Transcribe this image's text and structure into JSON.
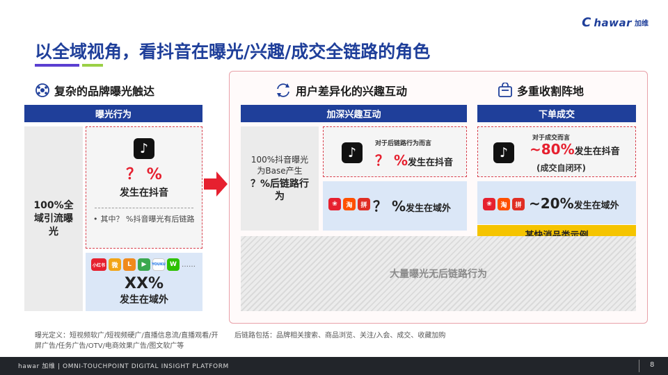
{
  "logo": {
    "text": "hawar",
    "cn": "加维"
  },
  "title": "以全域视角，看抖音在曝光/兴趣/成交全链路的角色",
  "left": {
    "heading": "复杂的品牌曝光触达",
    "bar": "曝光行为",
    "full_domain": "100%全域引流曝光",
    "pct": "？ %",
    "in_douyin": "发生在抖音",
    "note": "其中？ %抖音曝光有后链路",
    "xx": "XX%",
    "outside": "发生在域外",
    "platforms": [
      "小红书",
      "微",
      "L",
      "▶",
      "YOUKU",
      "W"
    ],
    "ellipsis": "……"
  },
  "mid": {
    "heading": "用户差异化的兴趣互动",
    "bar": "加深兴趣互动",
    "base_text": "100%抖音曝光为Base产生",
    "base_pct": "？%后链路行为",
    "for_chain": "对于后链路行为而言",
    "pct_douyin": "？ %",
    "pct_douyin_suffix": "发生在抖音",
    "pct_out": "？ %",
    "pct_out_suffix": "发生在域外",
    "icons": [
      "淘",
      "拼"
    ]
  },
  "right": {
    "heading": "多重收割阵地",
    "bar": "下单成交",
    "for_deal": "对于成交而言",
    "pct_80": "~80%",
    "pct_80_suffix": "发生在抖音",
    "closed_loop": "(成交自闭环)",
    "pct_20": "~20%",
    "pct_20_suffix": "发生在域外",
    "example": "某快消品类示例",
    "icons": [
      "淘",
      "拼"
    ]
  },
  "hatch_text": "大量曝光无后链路行为",
  "footnote_left": "曝光定义：短视频软广/短视频硬广/直播信息流/直播观看/开屏广告/任务广告/OTV/电商效果广告/图文软广等",
  "footnote_right": "后链路包括：品牌相关搜索、商品浏览、关注/入会、成交、收藏加购",
  "footer": {
    "brand": "hawar 加维 | OMNI-TOUCHPOINT DIGITAL INSIGHT PLATFORM",
    "page": "8"
  },
  "colors": {
    "brand_blue": "#1f3f9a",
    "accent_red": "#e6202f",
    "accent_yellow": "#f5c400"
  }
}
